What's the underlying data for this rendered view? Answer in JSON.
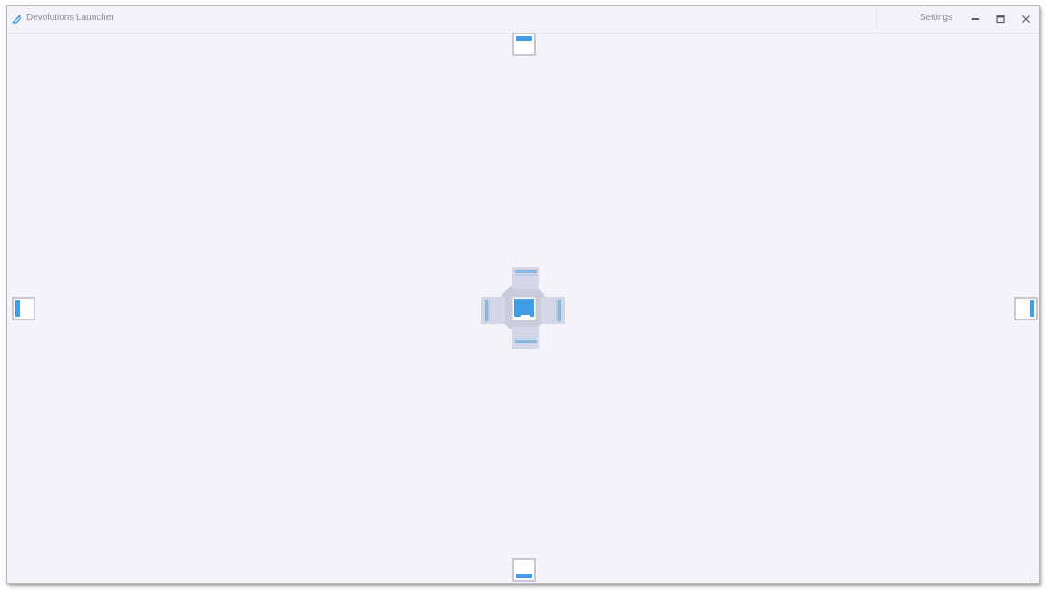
{
  "window": {
    "title": "Devolutions Launcher",
    "icon": "devolutions-launcher-logo-icon"
  },
  "titlebar": {
    "settings_label": "Settings",
    "minimize_icon": "minimize-icon",
    "maximize_icon": "maximize-icon",
    "close_icon": "close-icon"
  },
  "docking": {
    "edge_targets": [
      "top",
      "bottom",
      "left",
      "right"
    ],
    "center_targets": [
      "top",
      "bottom",
      "left",
      "right",
      "center"
    ],
    "accent_color": "#3f9ee6"
  }
}
